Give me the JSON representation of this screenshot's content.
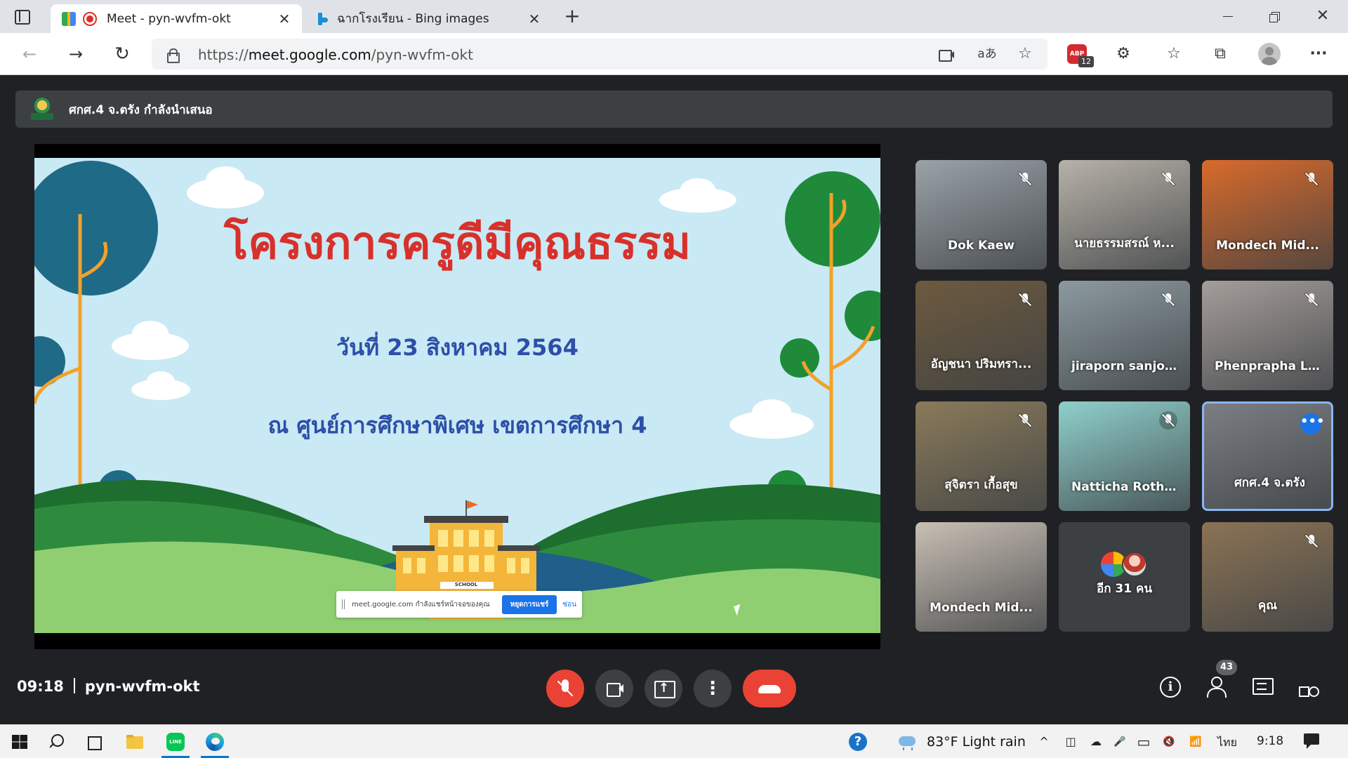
{
  "browser": {
    "tabs": [
      {
        "title": "Meet - pyn-wvfm-okt",
        "active": true
      },
      {
        "title": "ฉากโรงเรียน - Bing images",
        "active": false
      }
    ],
    "close_glyph": "✕",
    "new_tab_glyph": "+",
    "window_close_glyph": "✕",
    "address": {
      "scheme": "https://",
      "host": "meet.google.com",
      "path": "/pyn-wvfm-okt"
    },
    "extension_badge": "12",
    "icons": {
      "back": "←",
      "forward": "→",
      "reload": "↻",
      "read_aloud": "aあ",
      "favorite_add": "☆",
      "extensions": "⚙",
      "favorites": "☆",
      "collections": "⧉",
      "more": "···"
    }
  },
  "meet": {
    "presenting_banner": "ศกศ.4 จ.ตรัง กำลังนำเสนอ",
    "slide": {
      "title": "โครงการครูดีมีคุณธรรม",
      "date": "วันที่ 23 สิงหาคม 2564",
      "venue": "ณ ศูนย์การศึกษาพิเศษ เขตการศึกษา 4",
      "school_sign": "SCHOOL",
      "share_notice": "meet.google.com กำลังแชร์หน้าจอของคุณ",
      "share_stop": "หยุดการแชร์",
      "share_hide": "ซ่อน"
    },
    "participants": [
      {
        "name": "Dok Kaew",
        "muted": true,
        "bg": "#9aa2a8"
      },
      {
        "name": "นายธรรมสรณ์ ห...",
        "muted": true,
        "bg": "#b7b2a8"
      },
      {
        "name": "Mondech Mid...",
        "muted": true,
        "bg": "#d96a2b"
      },
      {
        "name": "อัญชนา ปริมทรา...",
        "muted": true,
        "bg": "#6d5a3f"
      },
      {
        "name": "jiraporn sanjo...",
        "muted": true,
        "bg": "#8c9aa0"
      },
      {
        "name": "Phenprapha L...",
        "muted": true,
        "bg": "#a59d9a"
      },
      {
        "name": "สุจิตรา เกื้อสุข",
        "muted": true,
        "bg": "#8a7a5a"
      },
      {
        "name": "Natticha Roth...",
        "muted": true,
        "bg": "#8fd0cc"
      },
      {
        "name": "ศกศ.4 จ.ตรัง",
        "muted": false,
        "speaking": true,
        "bg": "#7b7e82"
      },
      {
        "name": "Mondech Mid...",
        "muted": false,
        "bg": "#c9bfb4"
      },
      {
        "name": "อีก 31 คน",
        "more_tile": true,
        "bg": "#3c4043"
      },
      {
        "name": "คุณ",
        "muted": true,
        "bg": "#8b7355"
      }
    ],
    "more_options_glyph": "•••",
    "clock": "09:18",
    "meeting_code": "pyn-wvfm-okt",
    "controls": {
      "more_glyph": "⋮"
    },
    "info_glyph": "i",
    "people_count": "43"
  },
  "taskbar": {
    "weather": "83°F  Light rain",
    "tray_icons": {
      "chevron": "^",
      "meet_now": "◫",
      "onedrive": "☁",
      "microphone": "🎤",
      "battery": "▭",
      "volume_muted": "🔇",
      "wifi": "📶"
    },
    "language": "ไทย",
    "time": "9:18"
  },
  "colors": {
    "meet_bg": "#202124",
    "end_call": "#ea4335",
    "accent": "#1a73e8",
    "slide_sky": "#c9e9f4"
  }
}
